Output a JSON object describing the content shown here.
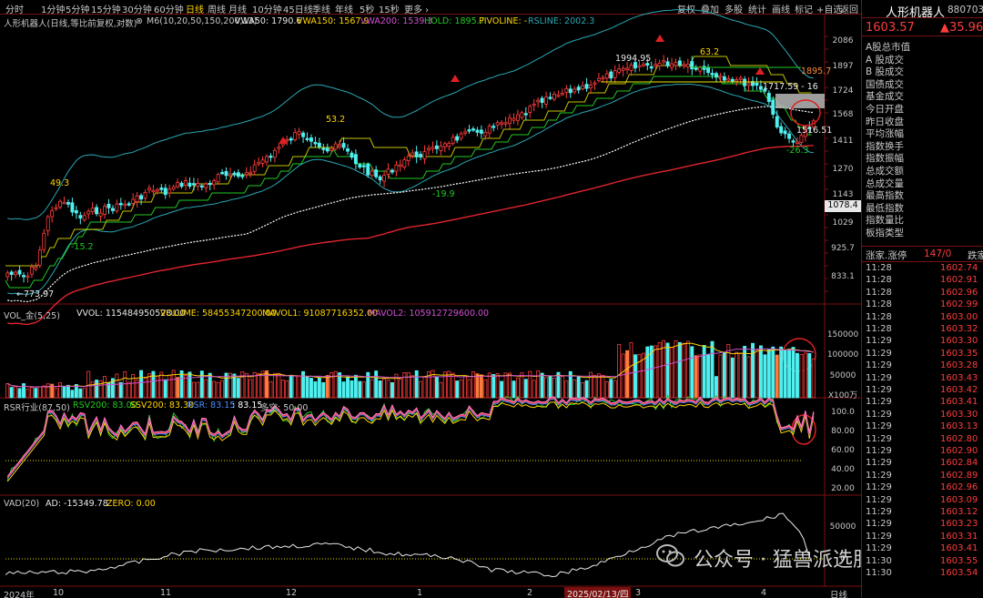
{
  "toolbar": {
    "periods": [
      "分时",
      "1分钟",
      "5分钟",
      "15分钟",
      "30分钟",
      "60分钟",
      "日线",
      "周线",
      "月线",
      "10分钟",
      "45日线",
      "季线",
      "年线",
      "5秒",
      "15秒",
      "更多 ›"
    ],
    "active_period": "日线",
    "actions": [
      "复权",
      "叠加",
      "多股",
      "统计",
      "画线",
      "标记",
      "+自选",
      "返回"
    ]
  },
  "main_legend": {
    "title": "人形机器人(日线,等比前复权,对数)",
    "ma": "M6(10,20,50,150,200,13)",
    "vwa50": "VWA50: 1790.6",
    "vwa150": "VWA150: 1567.9",
    "vwa200": "VWA200: 1539.3",
    "hold": "HOLD: 1895.7",
    "pivot": "PIVOLINE: -",
    "rsline": "RSLINE: 2002.3"
  },
  "price_axis": [
    "2086",
    "1897",
    "1724",
    "1568",
    "1411",
    "1270",
    "1143",
    "1029",
    "925.7",
    "833.1"
  ],
  "current_price_tag": "1078.4",
  "price_annotations": {
    "low": "773.97",
    "p49": "49.3",
    "m152": "-15.2",
    "p532": "53.2",
    "m199": "-19.9",
    "high1": "1994.95",
    "p632": "63.2",
    "hold_label": "1895.7",
    "cur_band": "1717.59 - 16",
    "bottom": "1516.51",
    "m263": "-26.3"
  },
  "vol_legend": {
    "label": "VOL_金(5,25)",
    "vvol": "VVOL: 115484950528.00",
    "volume": "VOLUME: 58455347200.00",
    "mavol1": "MAVOL1: 91087716352.00",
    "mavol2": "MAVOL2: 105912729600.00"
  },
  "vol_axis": [
    "150000",
    "100000",
    "50000",
    "X100万"
  ],
  "rsr_legend": {
    "label": "RSR行业(87,50)",
    "rsv": "RSV200: 83.00",
    "ssv": "SSV200: 83.30",
    "rsr": "RSR: 83.15",
    "val": ": 83.15",
    "duo": "多空: 50.00"
  },
  "rsr_axis": [
    "100.0",
    "80.00",
    "60.00",
    "40.00",
    "20.00"
  ],
  "vad_legend": {
    "label": "VAD(20)",
    "ad": "AD: -15349.78",
    "zero": "ZERO: 0.00"
  },
  "vad_axis": [
    "50000",
    "0"
  ],
  "date_axis": {
    "labels": [
      "2024年",
      "10",
      "11",
      "12",
      "1",
      "2",
      "3",
      "4"
    ],
    "cursor_date": "2025/02/13/四",
    "period": "日线"
  },
  "sidebar": {
    "title": "人形机器人",
    "code": "880703",
    "price": "1603.57",
    "change": "▲35.96",
    "items": [
      "A股总市值",
      "A 股成交",
      "B 股成交",
      "国债成交",
      "基金成交",
      "今日开盘",
      "昨日收盘",
      "平均涨幅",
      "指数换手",
      "指数振幅",
      "总成交额",
      "总成交量",
      "最高指数",
      "最低指数",
      "指数量比",
      "板指类型"
    ],
    "limit_label": "涨家.涨停",
    "limit_value": "147/0",
    "limit_suffix": "跌家",
    "ticks": [
      [
        "11:28",
        "1602.74"
      ],
      [
        "11:28",
        "1602.91"
      ],
      [
        "11:28",
        "1602.96"
      ],
      [
        "11:28",
        "1602.99"
      ],
      [
        "11:28",
        "1603.00"
      ],
      [
        "11:28",
        "1603.32"
      ],
      [
        "11:29",
        "1603.30"
      ],
      [
        "11:29",
        "1603.35"
      ],
      [
        "11:29",
        "1603.28"
      ],
      [
        "11:29",
        "1603.43"
      ],
      [
        "11:29",
        "1603.42"
      ],
      [
        "11:29",
        "1603.41"
      ],
      [
        "11:29",
        "1603.30"
      ],
      [
        "11:29",
        "1603.13"
      ],
      [
        "11:29",
        "1602.80"
      ],
      [
        "11:29",
        "1602.90"
      ],
      [
        "11:29",
        "1602.84"
      ],
      [
        "11:29",
        "1602.89"
      ],
      [
        "11:29",
        "1602.96"
      ],
      [
        "11:29",
        "1603.09"
      ],
      [
        "11:29",
        "1603.12"
      ],
      [
        "11:29",
        "1603.23"
      ],
      [
        "11:29",
        "1603.31"
      ],
      [
        "11:29",
        "1603.41"
      ],
      [
        "11:30",
        "1603.55"
      ],
      [
        "11:30",
        "1603.54"
      ]
    ]
  },
  "watermark": "公众号 · 猛兽派选股",
  "colors": {
    "up": "#ff3c3c",
    "down": "#4ff0f0",
    "accent_yellow": "#ffd400",
    "ma_red": "#e0242e",
    "ma_green": "#22c822",
    "ma_yellow": "#e6e600",
    "band_cyan": "#2aa7b4"
  }
}
